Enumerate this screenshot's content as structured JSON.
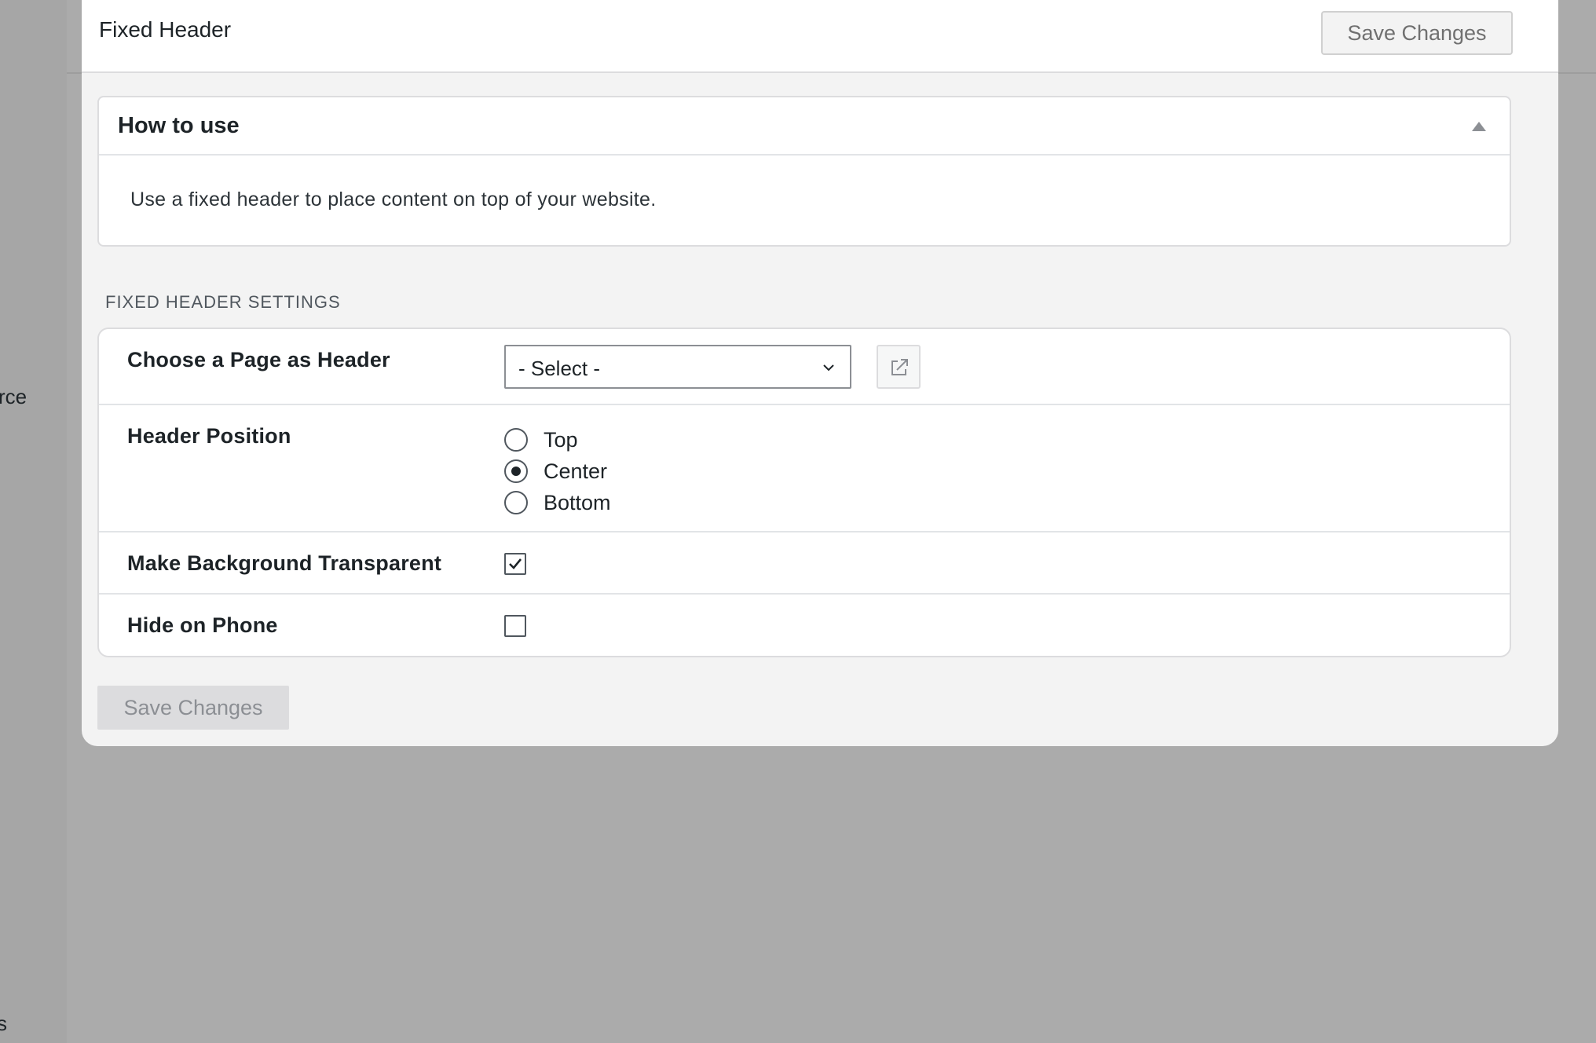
{
  "background": {
    "sidebar_fragment_1": "rce",
    "sidebar_fragment_2": "s"
  },
  "modal": {
    "title": "Fixed Header",
    "save_top_label": "Save Changes",
    "save_bottom_label": "Save Changes"
  },
  "how_to_use": {
    "title": "How to use",
    "body": "Use a fixed header to place content on top of your website.",
    "toggle_icon": "triangle-up-icon",
    "expanded": true
  },
  "settings": {
    "section_heading": "FIXED HEADER SETTINGS",
    "page_header": {
      "label": "Choose a Page as Header",
      "selected": "- Select -",
      "open_icon": "external-link-icon"
    },
    "header_position": {
      "label": "Header Position",
      "options": [
        {
          "label": "Top",
          "checked": false
        },
        {
          "label": "Center",
          "checked": true
        },
        {
          "label": "Bottom",
          "checked": false
        }
      ]
    },
    "transparent_background": {
      "label": "Make Background Transparent",
      "checked": true
    },
    "hide_on_phone": {
      "label": "Hide on Phone",
      "checked": false
    }
  },
  "colors": {
    "overlay": "#ababab",
    "modal_background": "#f3f3f3",
    "card_background": "#ffffff",
    "border": "#dcdcde",
    "text": "#1d2327"
  }
}
